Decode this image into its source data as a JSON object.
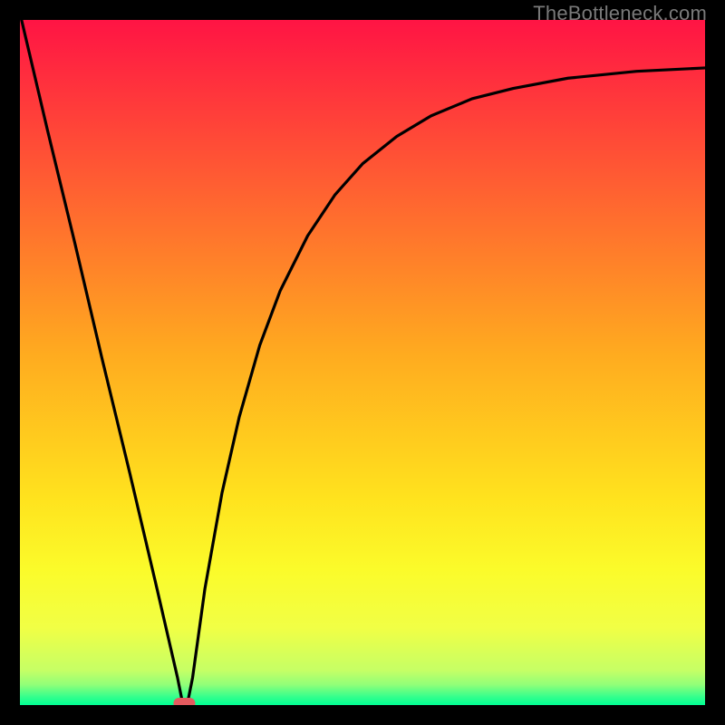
{
  "watermark": "TheBottleneck.com",
  "chart_data": {
    "type": "line",
    "title": "",
    "xlabel": "",
    "ylabel": "",
    "xlim": [
      0,
      100
    ],
    "ylim": [
      0,
      100
    ],
    "grid": false,
    "legend": false,
    "gradient_stops": [
      {
        "offset": 0.0,
        "color": "#ff1444"
      },
      {
        "offset": 0.488,
        "color": "#ffab1f"
      },
      {
        "offset": 0.7,
        "color": "#ffe31e"
      },
      {
        "offset": 0.802,
        "color": "#fbfb2a"
      },
      {
        "offset": 0.887,
        "color": "#f1ff45"
      },
      {
        "offset": 0.949,
        "color": "#c6ff65"
      },
      {
        "offset": 0.97,
        "color": "#92ff78"
      },
      {
        "offset": 0.987,
        "color": "#39ff8c"
      },
      {
        "offset": 1.0,
        "color": "#00ff93"
      }
    ],
    "curve_points": [
      {
        "x": 0.0,
        "y": 101.0
      },
      {
        "x": 4.0,
        "y": 84.0
      },
      {
        "x": 8.0,
        "y": 67.5
      },
      {
        "x": 12.0,
        "y": 50.5
      },
      {
        "x": 16.0,
        "y": 34.0
      },
      {
        "x": 20.0,
        "y": 17.0
      },
      {
        "x": 23.0,
        "y": 4.0
      },
      {
        "x": 23.7,
        "y": 0.5
      },
      {
        "x": 24.5,
        "y": 0.5
      },
      {
        "x": 25.2,
        "y": 4.0
      },
      {
        "x": 27.0,
        "y": 17.0
      },
      {
        "x": 29.5,
        "y": 31.0
      },
      {
        "x": 32.0,
        "y": 42.0
      },
      {
        "x": 35.0,
        "y": 52.5
      },
      {
        "x": 38.0,
        "y": 60.5
      },
      {
        "x": 42.0,
        "y": 68.5
      },
      {
        "x": 46.0,
        "y": 74.5
      },
      {
        "x": 50.0,
        "y": 79.0
      },
      {
        "x": 55.0,
        "y": 83.0
      },
      {
        "x": 60.0,
        "y": 86.0
      },
      {
        "x": 66.0,
        "y": 88.5
      },
      {
        "x": 72.0,
        "y": 90.0
      },
      {
        "x": 80.0,
        "y": 91.5
      },
      {
        "x": 90.0,
        "y": 92.5
      },
      {
        "x": 100.0,
        "y": 93.0
      }
    ],
    "marker": {
      "x": 24.0,
      "y": 0.0,
      "color": "#e45a5f"
    }
  }
}
